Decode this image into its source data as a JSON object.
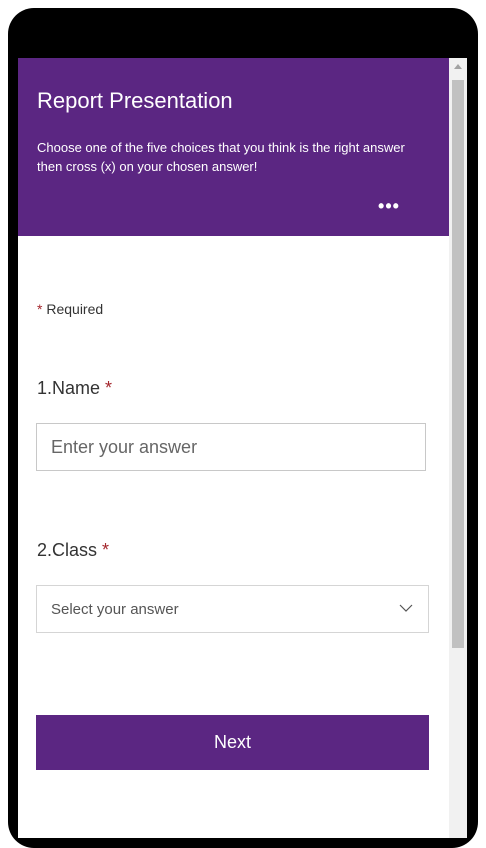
{
  "form": {
    "title": "Report Presentation",
    "description": "Choose one of the five choices that you think is the right answer then cross (x) on your chosen answer!",
    "more_label": "•••",
    "required_star": "*",
    "required_label": "Required",
    "questions": [
      {
        "number": "1.",
        "label": "Name",
        "star": "*",
        "placeholder": "Enter your answer"
      },
      {
        "number": "2.",
        "label": "Class",
        "star": "*",
        "placeholder": "Select your answer"
      }
    ],
    "next_label": "Next"
  },
  "icons": {
    "more": "more-dots-icon",
    "dropdown": "chevron-down-icon",
    "scroll_up": "scroll-up-arrow-icon"
  },
  "colors": {
    "header_bg": "#5b2682",
    "button_bg": "#5b2682",
    "required_star": "#a4262c"
  }
}
